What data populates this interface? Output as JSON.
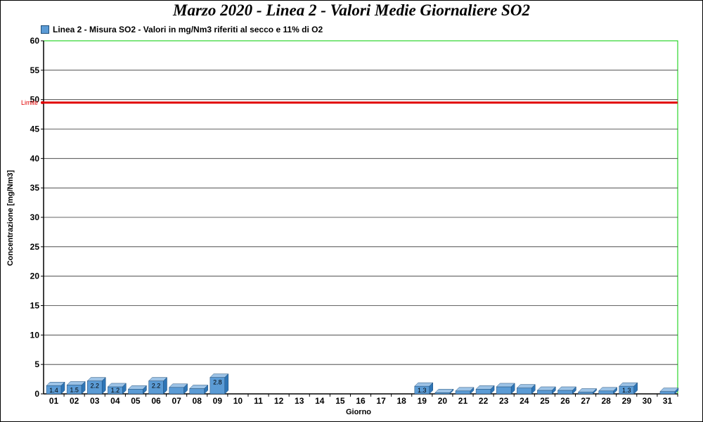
{
  "chart_data": {
    "type": "bar",
    "title": "Marzo 2020 - Linea 2 - Valori Medie Giornaliere SO2",
    "legend": "Linea 2 - Misura SO2 - Valori in mg/Nm3 riferiti al secco e 11% di O2",
    "xlabel": "Giorno",
    "ylabel": "Concentrazione [mg/Nm3]",
    "ylim": [
      0,
      60
    ],
    "yticks": [
      "0",
      "5",
      "10",
      "15",
      "20",
      "25",
      "30",
      "35",
      "40",
      "45",
      "50",
      "55",
      "60"
    ],
    "grid": true,
    "categories": [
      "01",
      "02",
      "03",
      "04",
      "05",
      "06",
      "07",
      "08",
      "09",
      "10",
      "11",
      "12",
      "13",
      "14",
      "15",
      "16",
      "17",
      "18",
      "19",
      "20",
      "21",
      "22",
      "23",
      "24",
      "25",
      "26",
      "27",
      "28",
      "29",
      "30",
      "31"
    ],
    "series": [
      {
        "name": "Linea 2 - Misura SO2 - Valori in mg/Nm3 riferiti al secco e 11% di O2",
        "values": [
          1.4,
          1.5,
          2.2,
          1.2,
          0.8,
          2.2,
          1.1,
          0.9,
          2.8,
          0,
          0,
          0,
          0,
          0,
          0,
          0,
          0,
          0,
          1.3,
          0.2,
          0.5,
          0.8,
          1.2,
          1.0,
          0.6,
          0.6,
          0.3,
          0.5,
          1.3,
          0,
          0.4
        ],
        "labels": [
          "1.4",
          "1.5",
          "2.2",
          "1.2",
          "",
          "2.2",
          "",
          "",
          "2.8",
          "",
          "",
          "",
          "",
          "",
          "",
          "",
          "",
          "",
          "1.3",
          "",
          "",
          "",
          "",
          "",
          "",
          "",
          "",
          "",
          "1.3",
          "",
          ""
        ]
      }
    ],
    "limit": {
      "label": "Limite",
      "value": 49.5,
      "color": "#e00000"
    },
    "colors": {
      "bar": "#5b9bd5",
      "bar_top": "#9dc3e6",
      "bar_side": "#2e75b6",
      "plot_border": "#00cc00",
      "grid": "#000000"
    }
  }
}
